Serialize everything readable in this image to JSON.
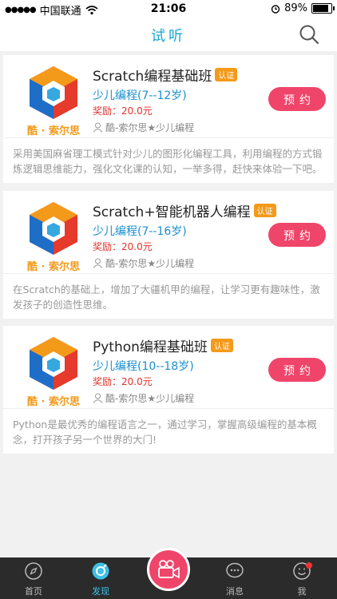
{
  "status": {
    "carrier": "中国联通",
    "time": "21:06",
    "battery": "89%"
  },
  "header": {
    "title": "试听"
  },
  "courses": [
    {
      "title": "Scratch编程基础班",
      "badge": "认证",
      "category": "少儿编程(7--12岁)",
      "reward": "奖励：20.0元",
      "org": "酷-索尔思★少儿编程",
      "button": "预约",
      "logo_text": "酷 · 索尔思",
      "description": "采用美国麻省理工模式针对少儿的图形化编程工具，利用编程的方式锻炼逻辑思维能力，强化文化课的认知，一举多得，赶快来体验一下吧。"
    },
    {
      "title": "Scratch+智能机器人编程",
      "badge": "认证",
      "category": "少儿编程(7--16岁)",
      "reward": "奖励：20.0元",
      "org": "酷-索尔思★少儿编程",
      "button": "预约",
      "logo_text": "酷 · 索尔思",
      "description": "在Scratch的基础上，增加了大疆机甲的编程，让学习更有趣味性，激发孩子的创造性思维。"
    },
    {
      "title": "Python编程基础班",
      "badge": "认证",
      "category": "少儿编程(10--18岁)",
      "reward": "奖励：20.0元",
      "org": "酷-索尔思★少儿编程",
      "button": "预约",
      "logo_text": "酷 · 索尔思",
      "description": "Python是最优秀的编程语言之一，通过学习，掌握高级编程的基本概念，打开孩子另一个世界的大门!"
    }
  ],
  "tabs": [
    {
      "label": "首页",
      "icon": "compass-icon"
    },
    {
      "label": "发现",
      "icon": "discover-icon"
    },
    {
      "label": "",
      "icon": "video-camera-icon"
    },
    {
      "label": "消息",
      "icon": "chat-icon"
    },
    {
      "label": "我",
      "icon": "profile-icon"
    }
  ],
  "colors": {
    "accent": "#1aa7d3",
    "button": "#f0456a",
    "badge": "#f39a1a",
    "reward": "#e2322a"
  }
}
